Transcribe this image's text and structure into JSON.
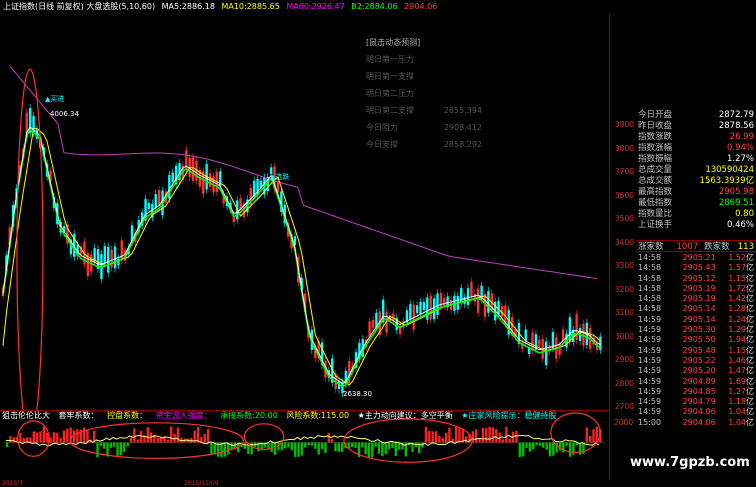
{
  "topbar": {
    "title": "上证指数(日线 前复权) 大盘选股(5,10,60)",
    "ma5_label": "MA5:",
    "ma5": "2886.18",
    "ma10_label": "MA10:",
    "ma10": "2885.65",
    "ma60_label": "MA60:",
    "ma60": "2926.47",
    "b2_label": "B2:",
    "b2": "2884.06",
    "last": "2904.06"
  },
  "pressure": {
    "title": "[鼠击动态预测]",
    "rows": [
      {
        "label": "明日第一压力",
        "value": ""
      },
      {
        "label": "明日第一支撑",
        "value": ""
      },
      {
        "label": "明日第二压力",
        "value": ""
      },
      {
        "label": "明日第二支撑",
        "value": "2855.394"
      },
      {
        "label": "今日阻力",
        "value": "2908.412"
      },
      {
        "label": "今日支撑",
        "value": "2858.292"
      }
    ]
  },
  "chart_labels": {
    "high": "4006.34",
    "low": "2638.30",
    "buy1": "▲买进",
    "buy2": "▲选跌"
  },
  "price_axis": [
    "3900",
    "3800",
    "3700",
    "3600",
    "3500",
    "3400",
    "3300",
    "3200",
    "3100",
    "3000",
    "2900",
    "2800",
    "2700"
  ],
  "sub_header": {
    "title": "狙击伦伦比大",
    "s1": "套牢系数：",
    "s2": "控盘系数：",
    "s3": "资金流入强度：",
    "s4": "承接系数:20.00",
    "s5": "风险系数:115.00",
    "s6": "★主力动向建议：多空平衡",
    "s7": "★庄家风险提示：稳健持股"
  },
  "sub_axis": "2000",
  "stats": [
    {
      "label": "今日开盘",
      "value": "2872.79",
      "color": "#ffffff"
    },
    {
      "label": "昨日收盘",
      "value": "2878.56",
      "color": "#ffffff"
    },
    {
      "label": "指数涨跌",
      "value": "26.99",
      "color": "#ff4040"
    },
    {
      "label": "指数涨幅",
      "value": "0.94%",
      "color": "#ff4040"
    },
    {
      "label": "指数振幅",
      "value": "1.27%",
      "color": "#ffffff"
    },
    {
      "label": "总成交量",
      "value": "130590424",
      "color": "#ffff00"
    },
    {
      "label": "总成交额",
      "value": "1563.3939亿",
      "color": "#ffff00"
    },
    {
      "label": "最高指数",
      "value": "2905.98",
      "color": "#ff4040"
    },
    {
      "label": "最低指数",
      "value": "2869.51",
      "color": "#00ff00"
    },
    {
      "label": "指数量比",
      "value": "0.80",
      "color": "#ffff00"
    },
    {
      "label": "上证换手",
      "value": "0.46%",
      "color": "#ffffff"
    }
  ],
  "updown": {
    "up_label": "涨家数",
    "up": "1007",
    "down_label": "跌家数",
    "down": "113"
  },
  "trades": [
    {
      "time": "14:58",
      "price": "2905.21",
      "vol": "1.52",
      "unit": "亿"
    },
    {
      "time": "14:58",
      "price": "2905.43",
      "vol": "1.57",
      "unit": "亿"
    },
    {
      "time": "14:58",
      "price": "2905.12",
      "vol": "1.15",
      "unit": "亿"
    },
    {
      "time": "14:58",
      "price": "2905.19",
      "vol": "1.72",
      "unit": "亿"
    },
    {
      "time": "14:58",
      "price": "2905.19",
      "vol": "1.42",
      "unit": "亿"
    },
    {
      "time": "14:58",
      "price": "2905.14",
      "vol": "1.28",
      "unit": "亿"
    },
    {
      "time": "14:59",
      "price": "2905.14",
      "vol": "1.24",
      "unit": "亿"
    },
    {
      "time": "14:59",
      "price": "2905.30",
      "vol": "1.29",
      "unit": "亿"
    },
    {
      "time": "14:59",
      "price": "2905.50",
      "vol": "1.94",
      "unit": "亿"
    },
    {
      "time": "14:59",
      "price": "2905.48",
      "vol": "1.15",
      "unit": "亿"
    },
    {
      "time": "14:59",
      "price": "2905.22",
      "vol": "1.46",
      "unit": "亿"
    },
    {
      "time": "14:59",
      "price": "2905.20",
      "vol": "1.47",
      "unit": "亿"
    },
    {
      "time": "14:59",
      "price": "2904.89",
      "vol": "1.69",
      "unit": "亿"
    },
    {
      "time": "14:59",
      "price": "2904.85",
      "vol": "1.27",
      "unit": "亿"
    },
    {
      "time": "14:59",
      "price": "2904.79",
      "vol": "1.18",
      "unit": "亿"
    },
    {
      "time": "14:59",
      "price": "2904.06",
      "vol": "1.04",
      "unit": "亿"
    },
    {
      "time": "15:00",
      "price": "2904.06",
      "vol": "1.04",
      "unit": "亿"
    }
  ],
  "dates": [
    "2015/7",
    "2015/11/09"
  ],
  "watermark": "www.7gpzb.com",
  "colors": {
    "up": "#ff3030",
    "down": "#00ffff",
    "ma5": "#ffffff",
    "ma10": "#ffff00",
    "ma60": "#ff00ff",
    "axis": "#8b0000"
  }
}
